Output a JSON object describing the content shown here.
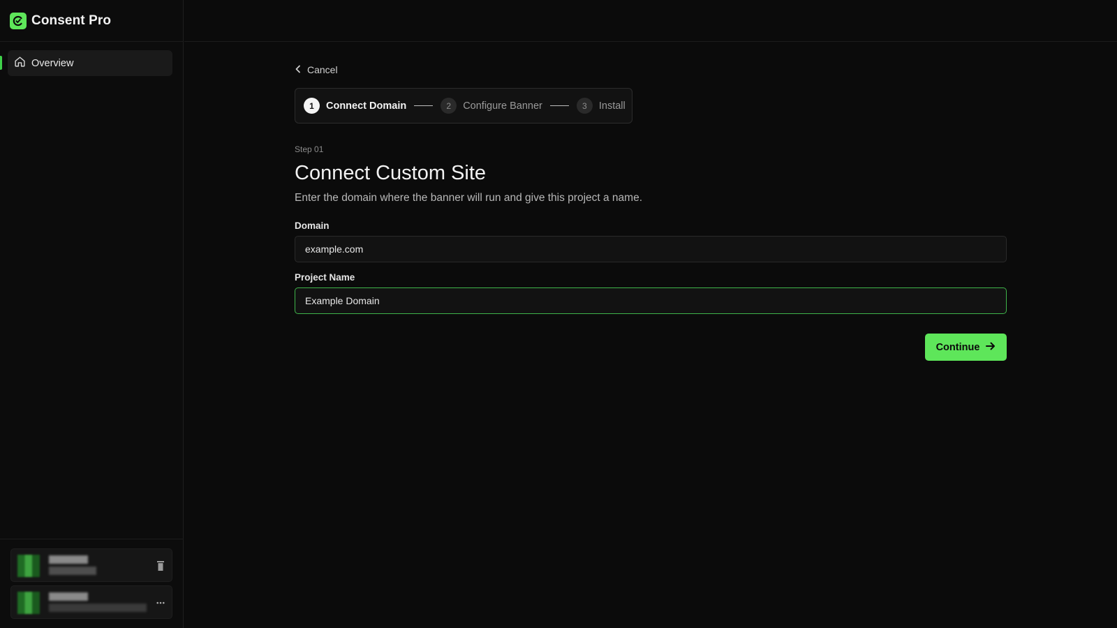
{
  "app": {
    "name": "Consent Pro"
  },
  "sidebar": {
    "items": [
      {
        "label": "Overview",
        "icon": "home-icon",
        "active": true
      }
    ]
  },
  "cancel": {
    "label": "Cancel"
  },
  "stepper": {
    "steps": [
      {
        "number": "1",
        "label": "Connect Domain",
        "active": true
      },
      {
        "number": "2",
        "label": "Configure Banner",
        "active": false
      },
      {
        "number": "3",
        "label": "Install",
        "active": false
      }
    ]
  },
  "form": {
    "eyebrow": "Step 01",
    "title": "Connect Custom Site",
    "subtitle": "Enter the domain where the banner will run and give this project a name.",
    "domain": {
      "label": "Domain",
      "value": "example.com"
    },
    "project_name": {
      "label": "Project Name",
      "value": "Example Domain"
    },
    "continue_label": "Continue"
  },
  "colors": {
    "accent": "#5ee65a",
    "background": "#0b0b0b",
    "focus_border": "#3fb54a"
  }
}
